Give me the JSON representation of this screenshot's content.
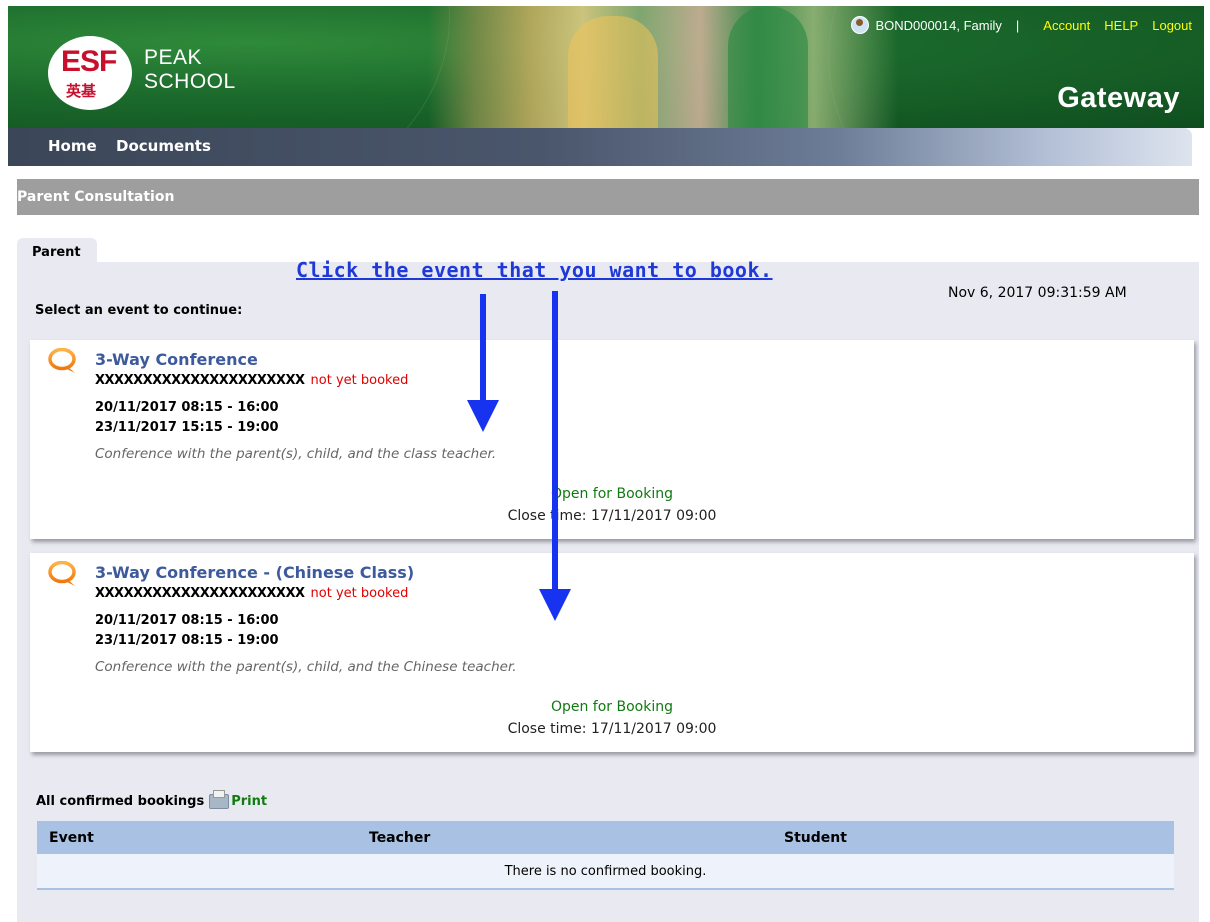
{
  "header": {
    "logo": {
      "esf": "ESF",
      "chinese": "英基"
    },
    "school_name_line1": "PEAK",
    "school_name_line2": "SCHOOL",
    "user": "BOND000014, Family",
    "separator": "|",
    "links": {
      "account": "Account",
      "help": "HELP",
      "logout": "Logout"
    },
    "app_name": "Gateway"
  },
  "nav": {
    "home": "Home",
    "documents": "Documents"
  },
  "section": {
    "title": "Parent Consultation"
  },
  "tab": {
    "label": "Parent"
  },
  "instruction": "Click the event that you want to book.",
  "datetime": "Nov 6, 2017 09:31:59 AM",
  "select_label": "Select an event to continue:",
  "events": [
    {
      "title": "3-Way Conference",
      "student": "XXXXXXXXXXXXXXXXXXXXXX",
      "status": "not yet booked",
      "date1": "20/11/2017 08:15 - 16:00",
      "date2": "23/11/2017 15:15 - 19:00",
      "description": "Conference with the parent(s), child, and the class teacher.",
      "open_status": "Open for Booking",
      "close_time": "Close time: 17/11/2017 09:00"
    },
    {
      "title": "3-Way Conference - (Chinese Class)",
      "student": "XXXXXXXXXXXXXXXXXXXXXX",
      "status": "not yet booked",
      "date1": "20/11/2017 08:15 - 16:00",
      "date2": "23/11/2017 08:15 - 19:00",
      "description": "Conference with the parent(s), child, and the Chinese teacher.",
      "open_status": "Open for Booking",
      "close_time": "Close time: 17/11/2017 09:00"
    }
  ],
  "bookings": {
    "label": "All confirmed bookings",
    "print": "Print",
    "columns": [
      "Event",
      "Teacher",
      "Student"
    ],
    "empty_message": "There is no confirmed booking."
  },
  "colors": {
    "banner_green": "#1b6a2c",
    "link_yellow": "#ffff00",
    "title_blue": "#3c5a9c",
    "status_red": "#e00000",
    "open_green": "#117a11",
    "annotation_blue": "#1733f0",
    "table_header": "#a9c1e2"
  },
  "icons": [
    "user-avatar-icon",
    "speech-bubble-icon",
    "printer-icon",
    "down-arrow-annotation"
  ]
}
